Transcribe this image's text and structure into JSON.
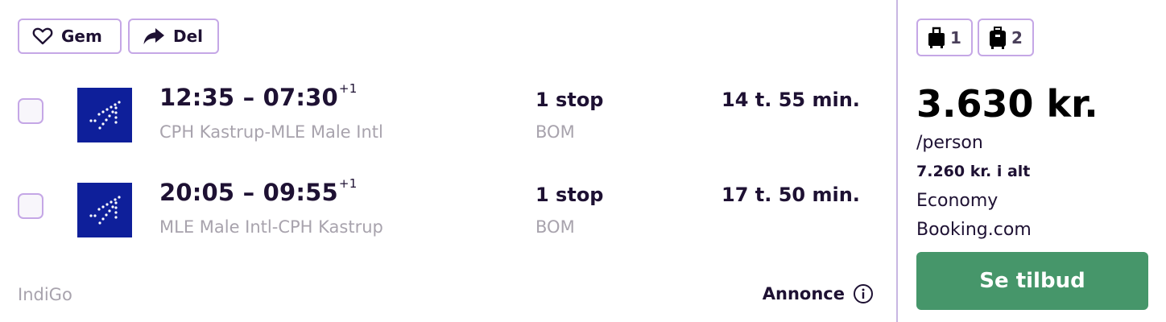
{
  "actions": {
    "save_label": "Gem",
    "share_label": "Del"
  },
  "flights": [
    {
      "time": "12:35 – 07:30",
      "day_offset": "+1",
      "route": "CPH Kastrup-MLE Male Intl",
      "stops": "1 stop",
      "via": "BOM",
      "duration": "14 t. 55 min."
    },
    {
      "time": "20:05 – 09:55",
      "day_offset": "+1",
      "route": "MLE Male Intl-CPH Kastrup",
      "stops": "1 stop",
      "via": "BOM",
      "duration": "17 t. 50 min."
    }
  ],
  "airline": "IndiGo",
  "ad_label": "Annonce",
  "baggage": {
    "carry_on": "1",
    "checked": "2"
  },
  "price": {
    "amount": "3.630 kr.",
    "per": "/person",
    "total": "7.260 kr. i alt",
    "cabin": "Economy",
    "provider": "Booking.com",
    "cta_label": "Se tilbud"
  },
  "colors": {
    "accent_border": "#c5a7e6",
    "cta": "#46966a",
    "logo_bg": "#0e1f9a",
    "text": "#1e1133",
    "muted": "#a8a3ad"
  },
  "icons": {
    "save": "heart-icon",
    "share": "share-arrow-icon",
    "carry_on": "carry-on-bag-icon",
    "checked": "checked-bag-icon",
    "info": "info-icon",
    "airline_logo": "indigo-logo"
  }
}
